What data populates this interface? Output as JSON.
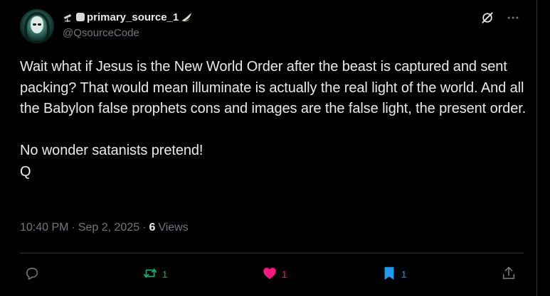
{
  "author": {
    "display_name": "primary_source_1",
    "handle": "@QsourceCode"
  },
  "tweet": {
    "text": "Wait what if Jesus is the New World Order after the beast is captured and sent packing? That would mean illuminate is actually the real light of the world. And all the Babylon false prophets cons and images are the false light, the present order.\n\nNo wonder satanists pretend!\nQ",
    "time": "10:40 PM",
    "separator": "·",
    "date": "Sep 2, 2025",
    "views_count": "6",
    "views_label": "Views"
  },
  "actions": {
    "reply_count": "",
    "repost_count": "1",
    "like_count": "1",
    "bookmark_count": "1"
  },
  "colors": {
    "background": "#000000",
    "text": "#e7e9ea",
    "muted": "#71767b",
    "repost": "#00ba7c",
    "like": "#f91880",
    "bookmark": "#1d9bf0"
  },
  "icons": {
    "header": [
      "grok-icon",
      "more-options-icon"
    ],
    "actions": [
      "reply-icon",
      "repost-icon",
      "like-icon",
      "bookmark-icon",
      "share-icon"
    ],
    "name_emojis": [
      "telescope-emoji",
      "square-emoji",
      "wing-emoji"
    ]
  }
}
